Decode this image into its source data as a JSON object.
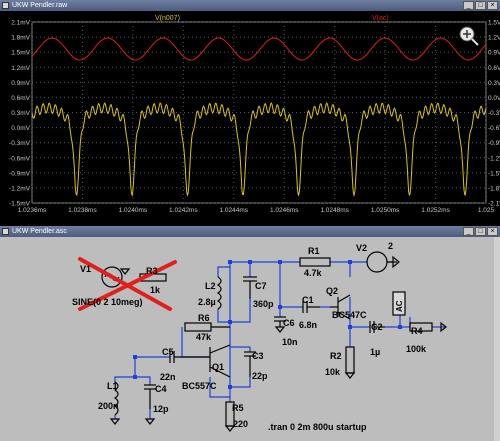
{
  "waveform_window": {
    "title": "UKW Pendler.raw",
    "traces": [
      {
        "name": "V(n007)",
        "color": "#d8c21a"
      },
      {
        "name": "V(ac)",
        "color": "#e0201c"
      }
    ],
    "left_axis": [
      "2.1mV",
      "1.8mV",
      "1.5mV",
      "1.2mV",
      "0.9mV",
      "0.6mV",
      "0.3mV",
      "0.0mV",
      "-0.3mV",
      "-0.6mV",
      "-0.9mV",
      "-1.2mV",
      "-1.5mV"
    ],
    "right_axis": [
      "1.5V",
      "1.2V",
      "0.9V",
      "0.6V",
      "0.3V",
      "0.0V",
      "-0.3V",
      "-0.6V",
      "-0.9V",
      "-1.2V",
      "-1.5V",
      "-1.8V",
      "-2.1V"
    ],
    "x_axis": [
      "1.0236ms",
      "1.0238ms",
      "1.0240ms",
      "1.0242ms",
      "1.0244ms",
      "1.0246ms",
      "1.0248ms",
      "1.0250ms",
      "1.0252ms",
      "1.025"
    ],
    "zoom_icon": "magnifier-plus-icon"
  },
  "schematic_window": {
    "title": "UKW Pendler.asc",
    "components": {
      "V1": "V1",
      "V1_value": "SINE(0 2 10meg)",
      "R3": "R3",
      "R3_value": "1k",
      "L2": "L2",
      "L2_value": "2.8µ",
      "C7": "C7",
      "C7_value": "360p",
      "R1": "R1",
      "R1_value": "4.7k",
      "V2": "V2",
      "V2_value": "2",
      "Q2": "Q2",
      "Q2_model": "BC547C",
      "C1": "C1",
      "C1_value": "6.8n",
      "C6": "C6",
      "C6_value": "10n",
      "R6": "R6",
      "R6_value": "47k",
      "C5": "C5",
      "C5_value": "22n",
      "Q1": "Q1",
      "Q1_model": "BC557C",
      "C3": "C3",
      "C3_value": "22p",
      "L1": "L1",
      "L1_value": "200n",
      "C4": "C4",
      "C4_value": "12p",
      "R5": "R5",
      "R5_value": "220",
      "R2": "R2",
      "R2_value": "10k",
      "C2": "C2",
      "C2_value": "1µ",
      "R4": "R4",
      "R4_value": "100k",
      "AC_label": "AC"
    },
    "directive": ".tran 0 2m 800u startup"
  }
}
